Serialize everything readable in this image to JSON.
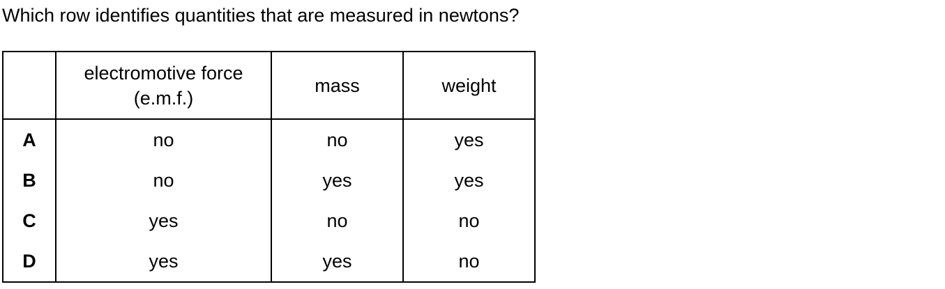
{
  "question": "Which row identifies quantities that are measured in newtons?",
  "table": {
    "headers": {
      "emf_line1": "electromotive force",
      "emf_line2": "(e.m.f.)",
      "mass": "mass",
      "weight": "weight"
    },
    "rows": [
      {
        "key": "A",
        "emf": "no",
        "mass": "no",
        "weight": "yes"
      },
      {
        "key": "B",
        "emf": "no",
        "mass": "yes",
        "weight": "yes"
      },
      {
        "key": "C",
        "emf": "yes",
        "mass": "no",
        "weight": "no"
      },
      {
        "key": "D",
        "emf": "yes",
        "mass": "yes",
        "weight": "no"
      }
    ]
  }
}
